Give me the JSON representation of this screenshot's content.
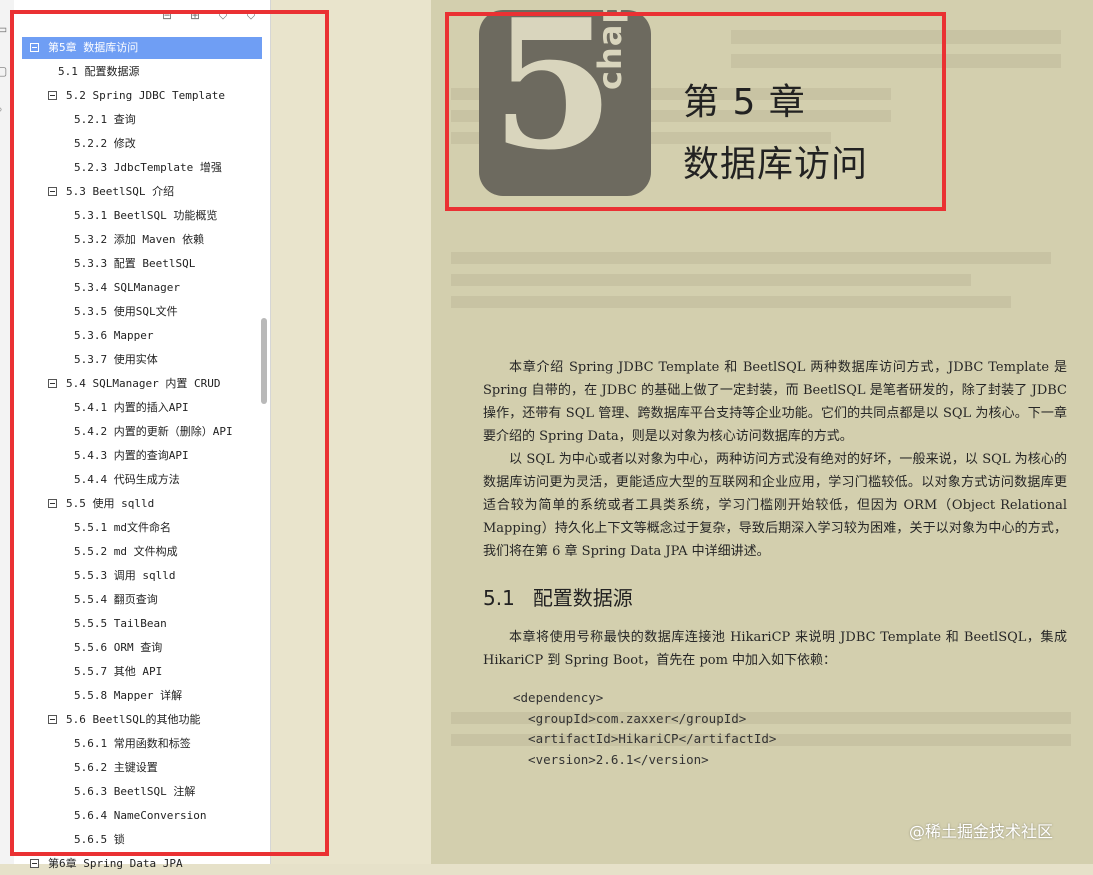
{
  "toolstrip": {
    "icons": [
      "page-thumbnail-icon",
      "attachment-icon",
      "search-icon"
    ]
  },
  "bookmarks_panel": {
    "toolbar_icons": [
      "expand-all-icon",
      "collapse-all-icon",
      "bookmark-icon",
      "bookmark-outline-icon"
    ],
    "items": [
      {
        "label": "第5章 数据库访问",
        "level": 0,
        "collapsible": true,
        "selected": true
      },
      {
        "label": "5.1 配置数据源",
        "level": 1,
        "collapsible": false
      },
      {
        "label": "5.2 Spring JDBC Template",
        "level": 1,
        "collapsible": true
      },
      {
        "label": "5.2.1 查询",
        "level": 2,
        "collapsible": false
      },
      {
        "label": "5.2.2 修改",
        "level": 2,
        "collapsible": false
      },
      {
        "label": "5.2.3 JdbcTemplate 增强",
        "level": 2,
        "collapsible": false
      },
      {
        "label": "5.3 BeetlSQL 介绍",
        "level": 1,
        "collapsible": true
      },
      {
        "label": "5.3.1 BeetlSQL 功能概览",
        "level": 2,
        "collapsible": false
      },
      {
        "label": "5.3.2 添加 Maven 依赖",
        "level": 2,
        "collapsible": false
      },
      {
        "label": "5.3.3 配置 BeetlSQL",
        "level": 2,
        "collapsible": false
      },
      {
        "label": "5.3.4 SQLManager",
        "level": 2,
        "collapsible": false
      },
      {
        "label": "5.3.5 使用SQL文件",
        "level": 2,
        "collapsible": false
      },
      {
        "label": "5.3.6 Mapper",
        "level": 2,
        "collapsible": false
      },
      {
        "label": "5.3.7 使用实体",
        "level": 2,
        "collapsible": false
      },
      {
        "label": "5.4 SQLManager 内置 CRUD",
        "level": 1,
        "collapsible": true
      },
      {
        "label": "5.4.1 内置的插入API",
        "level": 2,
        "collapsible": false
      },
      {
        "label": "5.4.2 内置的更新（删除）API",
        "level": 2,
        "collapsible": false
      },
      {
        "label": "5.4.3 内置的查询API",
        "level": 2,
        "collapsible": false
      },
      {
        "label": "5.4.4 代码生成方法",
        "level": 2,
        "collapsible": false
      },
      {
        "label": "5.5 使用 sqlld",
        "level": 1,
        "collapsible": true
      },
      {
        "label": "5.5.1 md文件命名",
        "level": 2,
        "collapsible": false
      },
      {
        "label": "5.5.2 md 文件构成",
        "level": 2,
        "collapsible": false
      },
      {
        "label": "5.5.3 调用 sqlld",
        "level": 2,
        "collapsible": false
      },
      {
        "label": "5.5.4 翻页查询",
        "level": 2,
        "collapsible": false
      },
      {
        "label": "5.5.5 TailBean",
        "level": 2,
        "collapsible": false
      },
      {
        "label": "5.5.6 ORM 查询",
        "level": 2,
        "collapsible": false
      },
      {
        "label": "5.5.7 其他 API",
        "level": 2,
        "collapsible": false
      },
      {
        "label": "5.5.8 Mapper 详解",
        "level": 2,
        "collapsible": false
      },
      {
        "label": "5.6 BeetlSQL的其他功能",
        "level": 1,
        "collapsible": true
      },
      {
        "label": "5.6.1 常用函数和标签",
        "level": 2,
        "collapsible": false
      },
      {
        "label": "5.6.2 主键设置",
        "level": 2,
        "collapsible": false
      },
      {
        "label": "5.6.3 BeetlSQL 注解",
        "level": 2,
        "collapsible": false
      },
      {
        "label": "5.6.4 NameConversion",
        "level": 2,
        "collapsible": false
      },
      {
        "label": "5.6.5 锁",
        "level": 2,
        "collapsible": false
      },
      {
        "label": "第6章 Spring Data JPA",
        "level": 0,
        "collapsible": true
      }
    ]
  },
  "document": {
    "chapter_number": "5",
    "chapter_word": "chapter",
    "chapter_title_line1": "第 5 章",
    "chapter_title_line2": "数据库访问",
    "paragraph1": "本章介绍 Spring JDBC Template 和 BeetlSQL 两种数据库访问方式，JDBC Template 是 Spring 自带的，在 JDBC 的基础上做了一定封装，而 BeetlSQL 是笔者研发的，除了封装了 JDBC 操作，还带有 SQL 管理、跨数据库平台支持等企业功能。它们的共同点都是以 SQL 为核心。下一章要介绍的 Spring Data，则是以对象为核心访问数据库的方式。",
    "paragraph2": "以 SQL 为中心或者以对象为中心，两种访问方式没有绝对的好坏，一般来说，以 SQL 为核心的数据库访问更为灵活，更能适应大型的互联网和企业应用，学习门槛较低。以对象方式访问数据库更适合较为简单的系统或者工具类系统，学习门槛刚开始较低，但因为 ORM（Object Relational Mapping）持久化上下文等概念过于复杂，导致后期深入学习较为困难，关于以对象为中心的方式，我们将在第 6 章 Spring Data JPA 中详细讲述。",
    "section_number": "5.1",
    "section_title": "配置数据源",
    "paragraph3": "本章将使用号称最快的数据库连接池 HikariCP 来说明 JDBC Template 和 BeetlSQL，集成 HikariCP 到 Spring Boot，首先在 pom 中加入如下依赖：",
    "code_lines": [
      "<dependency>",
      "  <groupId>com.zaxxer</groupId>",
      "  <artifactId>HikariCP</artifactId>",
      "  <version>2.6.1</version>"
    ],
    "watermark": "@稀土掘金技术社区"
  },
  "colors": {
    "highlight": "#ea3133",
    "selection": "#6f9ef4",
    "page_background": "#d3cfae"
  }
}
